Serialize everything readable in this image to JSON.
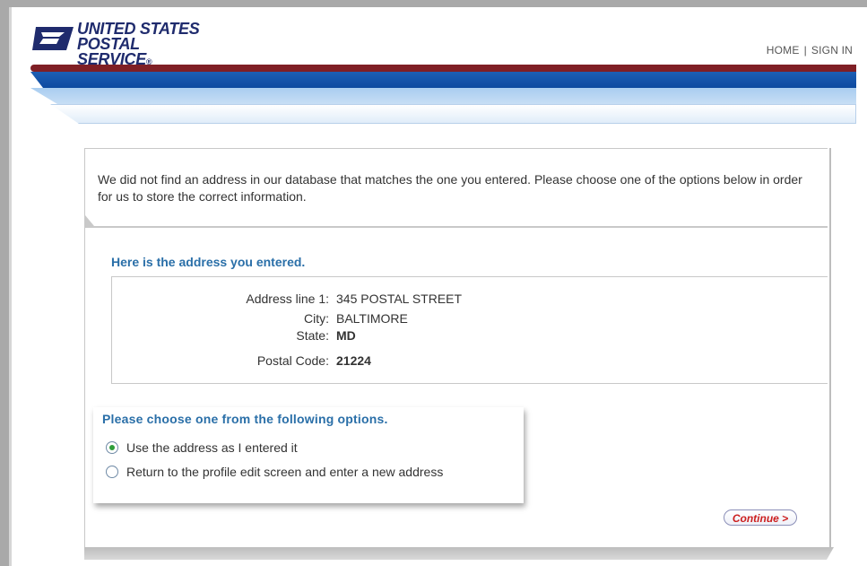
{
  "header": {
    "logo_line1": "UNITED STATES",
    "logo_line2": "POSTAL SERVICE",
    "logo_reg": "®",
    "nav_home": "HOME",
    "nav_separator": "|",
    "nav_signin": "SIGN IN"
  },
  "notice": {
    "text": "We did not find an address in our database that matches the one you entered. Please choose one of the options below in order for us to store the correct information."
  },
  "entered": {
    "title": "Here is the address you entered.",
    "fields": [
      {
        "label": "Address line 1:",
        "value": "345 POSTAL STREET"
      },
      {
        "label": "City:",
        "value": "BALTIMORE"
      },
      {
        "label": "State:",
        "value": "MD"
      },
      {
        "label": "Postal Code:",
        "value": "21224"
      }
    ]
  },
  "options": {
    "title": "Please choose one from the following options.",
    "items": [
      {
        "label": "Use the address as I entered it",
        "selected": true
      },
      {
        "label": "Return to the profile edit screen and enter a new address",
        "selected": false
      }
    ]
  },
  "actions": {
    "continue_label": "Continue >"
  },
  "colors": {
    "brand_navy": "#1f2b6d",
    "accent_blue": "#2a6fa8",
    "maroon": "#7f1f25",
    "continue_red": "#cc1f1f"
  }
}
